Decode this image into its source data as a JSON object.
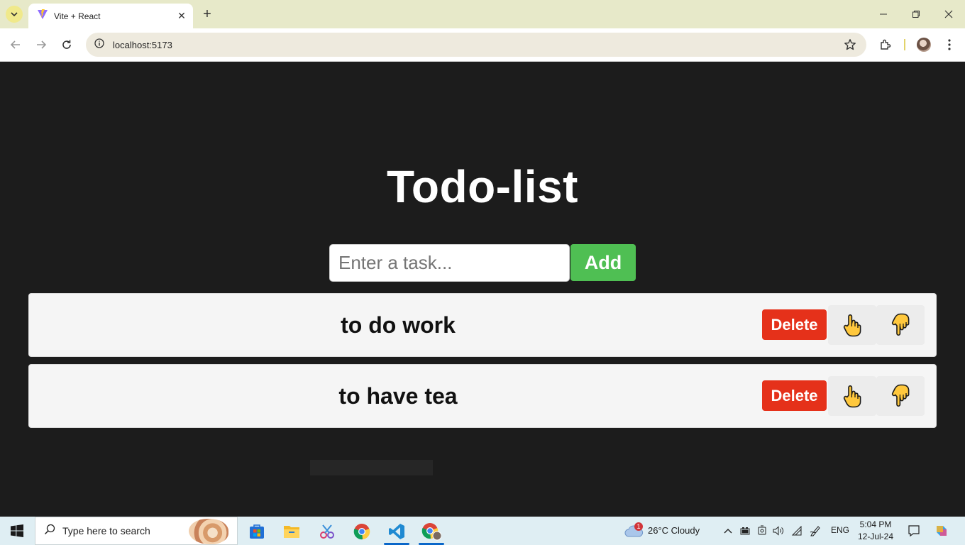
{
  "browser": {
    "tab_title": "Vite + React",
    "address": "localhost:5173",
    "icons": [
      "tab-search-icon",
      "vite-favicon-icon",
      "close-icon",
      "plus-icon",
      "minimize-icon",
      "restore-icon",
      "close-window-icon",
      "back-icon",
      "forward-icon",
      "reload-icon",
      "site-info-icon",
      "star-icon",
      "extensions-icon",
      "profile-avatar",
      "menu-dots-icon"
    ]
  },
  "app": {
    "title": "Todo-list",
    "input_placeholder": "Enter a task...",
    "input_value": "",
    "add_label": "Add",
    "todos": [
      {
        "text": "to do work",
        "delete_label": "Delete",
        "up_emoji": "👆",
        "down_emoji": "👇"
      },
      {
        "text": "to have tea",
        "delete_label": "Delete",
        "up_emoji": "👆",
        "down_emoji": "👇"
      }
    ],
    "colors": {
      "background": "#1c1c1c",
      "add_button": "#4fbf53",
      "delete_button": "#e5311a",
      "card": "#f5f5f5"
    }
  },
  "taskbar": {
    "search_placeholder": "Type here to search",
    "weather_badge": "1",
    "weather": "26°C  Cloudy",
    "language": "ENG",
    "time": "5:04 PM",
    "date": "12-Jul-24",
    "apps": [
      "microsoft-store-icon",
      "file-explorer-icon",
      "snipping-tool-icon",
      "chrome-icon",
      "vscode-icon",
      "chrome-profile-icon"
    ]
  }
}
